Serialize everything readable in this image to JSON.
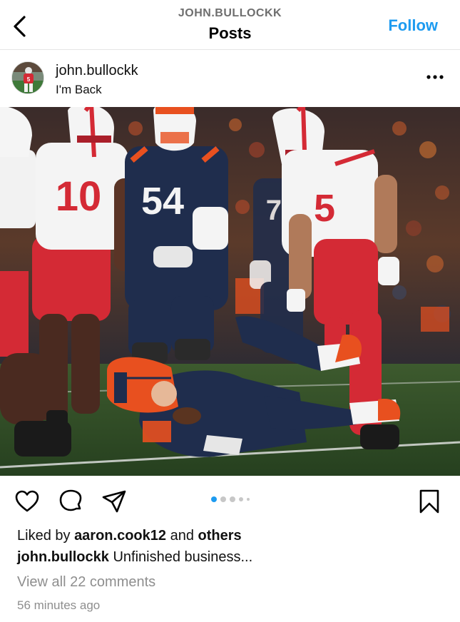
{
  "header": {
    "username": "JOHN.BULLOCKK",
    "title": "Posts",
    "follow_label": "Follow",
    "back_icon": "chevron-left-icon"
  },
  "post": {
    "username": "john.bullockk",
    "subtitle": "I'm Back",
    "more_icon": "ellipsis-icon",
    "photo": {
      "jersey_numbers": [
        "10",
        "54",
        "5",
        "70"
      ]
    },
    "carousel": {
      "count": 5,
      "active_index": 0
    },
    "liked_by_prefix": "Liked by ",
    "liked_by_user": "aaron.cook12",
    "liked_by_middle": " and ",
    "liked_by_others": "others",
    "caption_user": "john.bullockk",
    "caption_text": " Unfinished business...",
    "comments_link": "View all 22 comments",
    "timestamp": "56 minutes ago"
  },
  "icons": [
    "heart-icon",
    "comment-icon",
    "share-icon",
    "bookmark-icon"
  ],
  "colors": {
    "accent": "#1d9bf0",
    "muted": "#8e8e8e",
    "nebraska_red": "#d42a35",
    "illinois_navy": "#1f2d4d",
    "illinois_orange": "#e8501f"
  }
}
